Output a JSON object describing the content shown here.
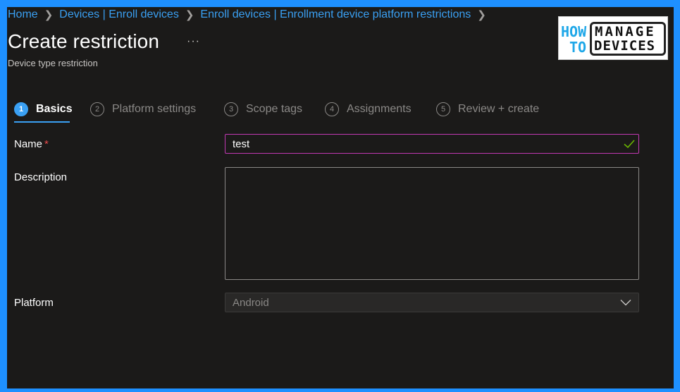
{
  "breadcrumb": {
    "items": [
      "Home",
      "Devices | Enroll devices",
      "Enroll devices | Enrollment device platform restrictions"
    ]
  },
  "page": {
    "title": "Create restriction",
    "more_label": "···",
    "subtitle": "Device type restriction"
  },
  "logo": {
    "how": "HOW",
    "to": "TO",
    "manage": "MANAGE",
    "devices": "DEVICES"
  },
  "wizard": {
    "steps": [
      {
        "number": "1",
        "label": "Basics",
        "active": true
      },
      {
        "number": "2",
        "label": "Platform settings",
        "active": false
      },
      {
        "number": "3",
        "label": "Scope tags",
        "active": false
      },
      {
        "number": "4",
        "label": "Assignments",
        "active": false
      },
      {
        "number": "5",
        "label": "Review + create",
        "active": false
      }
    ]
  },
  "form": {
    "name_label": "Name",
    "required_mark": "*",
    "name_value": "test",
    "description_label": "Description",
    "description_value": "",
    "platform_label": "Platform",
    "platform_value": "Android"
  },
  "colors": {
    "accent": "#3aa0f3",
    "input_focus_border": "#c239b3",
    "valid_check": "#6bb700",
    "required": "#e94b4b"
  },
  "icons": {
    "valid": "checkmark-icon",
    "dropdown": "chevron-down-icon",
    "breadcrumb_separator": "chevron-right-icon"
  }
}
